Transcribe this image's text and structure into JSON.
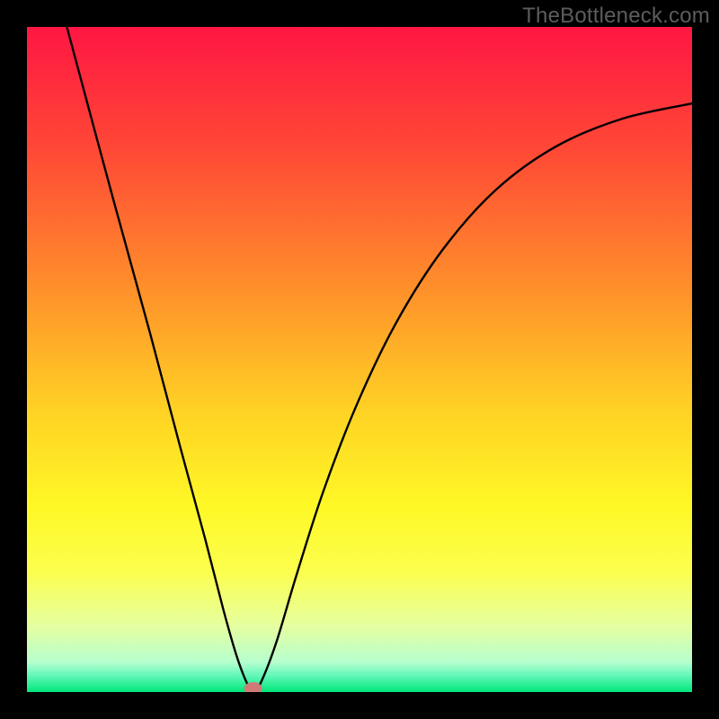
{
  "watermark": "TheBottleneck.com",
  "chart_data": {
    "type": "line",
    "title": "",
    "xlabel": "",
    "ylabel": "",
    "xlim": [
      0,
      1
    ],
    "ylim": [
      0,
      1
    ],
    "background_gradient": {
      "stops": [
        {
          "offset": 0.0,
          "color": "#ff1643"
        },
        {
          "offset": 0.18,
          "color": "#ff4736"
        },
        {
          "offset": 0.38,
          "color": "#ff8b2b"
        },
        {
          "offset": 0.58,
          "color": "#ffd324"
        },
        {
          "offset": 0.72,
          "color": "#fff826"
        },
        {
          "offset": 0.82,
          "color": "#fbff4e"
        },
        {
          "offset": 0.9,
          "color": "#e6ffa0"
        },
        {
          "offset": 0.955,
          "color": "#b6ffce"
        },
        {
          "offset": 0.975,
          "color": "#64f7b9"
        },
        {
          "offset": 1.0,
          "color": "#00e77a"
        }
      ]
    },
    "series": [
      {
        "name": "bottleneck-curve",
        "color": "#000000",
        "points": [
          {
            "x": 0.06,
            "y": 1.0
          },
          {
            "x": 0.13,
            "y": 0.74
          },
          {
            "x": 0.185,
            "y": 0.54
          },
          {
            "x": 0.23,
            "y": 0.37
          },
          {
            "x": 0.268,
            "y": 0.23
          },
          {
            "x": 0.295,
            "y": 0.125
          },
          {
            "x": 0.315,
            "y": 0.055
          },
          {
            "x": 0.33,
            "y": 0.015
          },
          {
            "x": 0.34,
            "y": 0.0
          },
          {
            "x": 0.352,
            "y": 0.015
          },
          {
            "x": 0.375,
            "y": 0.075
          },
          {
            "x": 0.405,
            "y": 0.175
          },
          {
            "x": 0.445,
            "y": 0.3
          },
          {
            "x": 0.495,
            "y": 0.43
          },
          {
            "x": 0.555,
            "y": 0.555
          },
          {
            "x": 0.625,
            "y": 0.665
          },
          {
            "x": 0.705,
            "y": 0.755
          },
          {
            "x": 0.795,
            "y": 0.82
          },
          {
            "x": 0.895,
            "y": 0.862
          },
          {
            "x": 1.0,
            "y": 0.885
          }
        ]
      }
    ],
    "marker": {
      "name": "min-marker",
      "x": 0.34,
      "y": 0.0,
      "rx": 10,
      "ry": 7,
      "fill": "#cf7a76"
    }
  }
}
